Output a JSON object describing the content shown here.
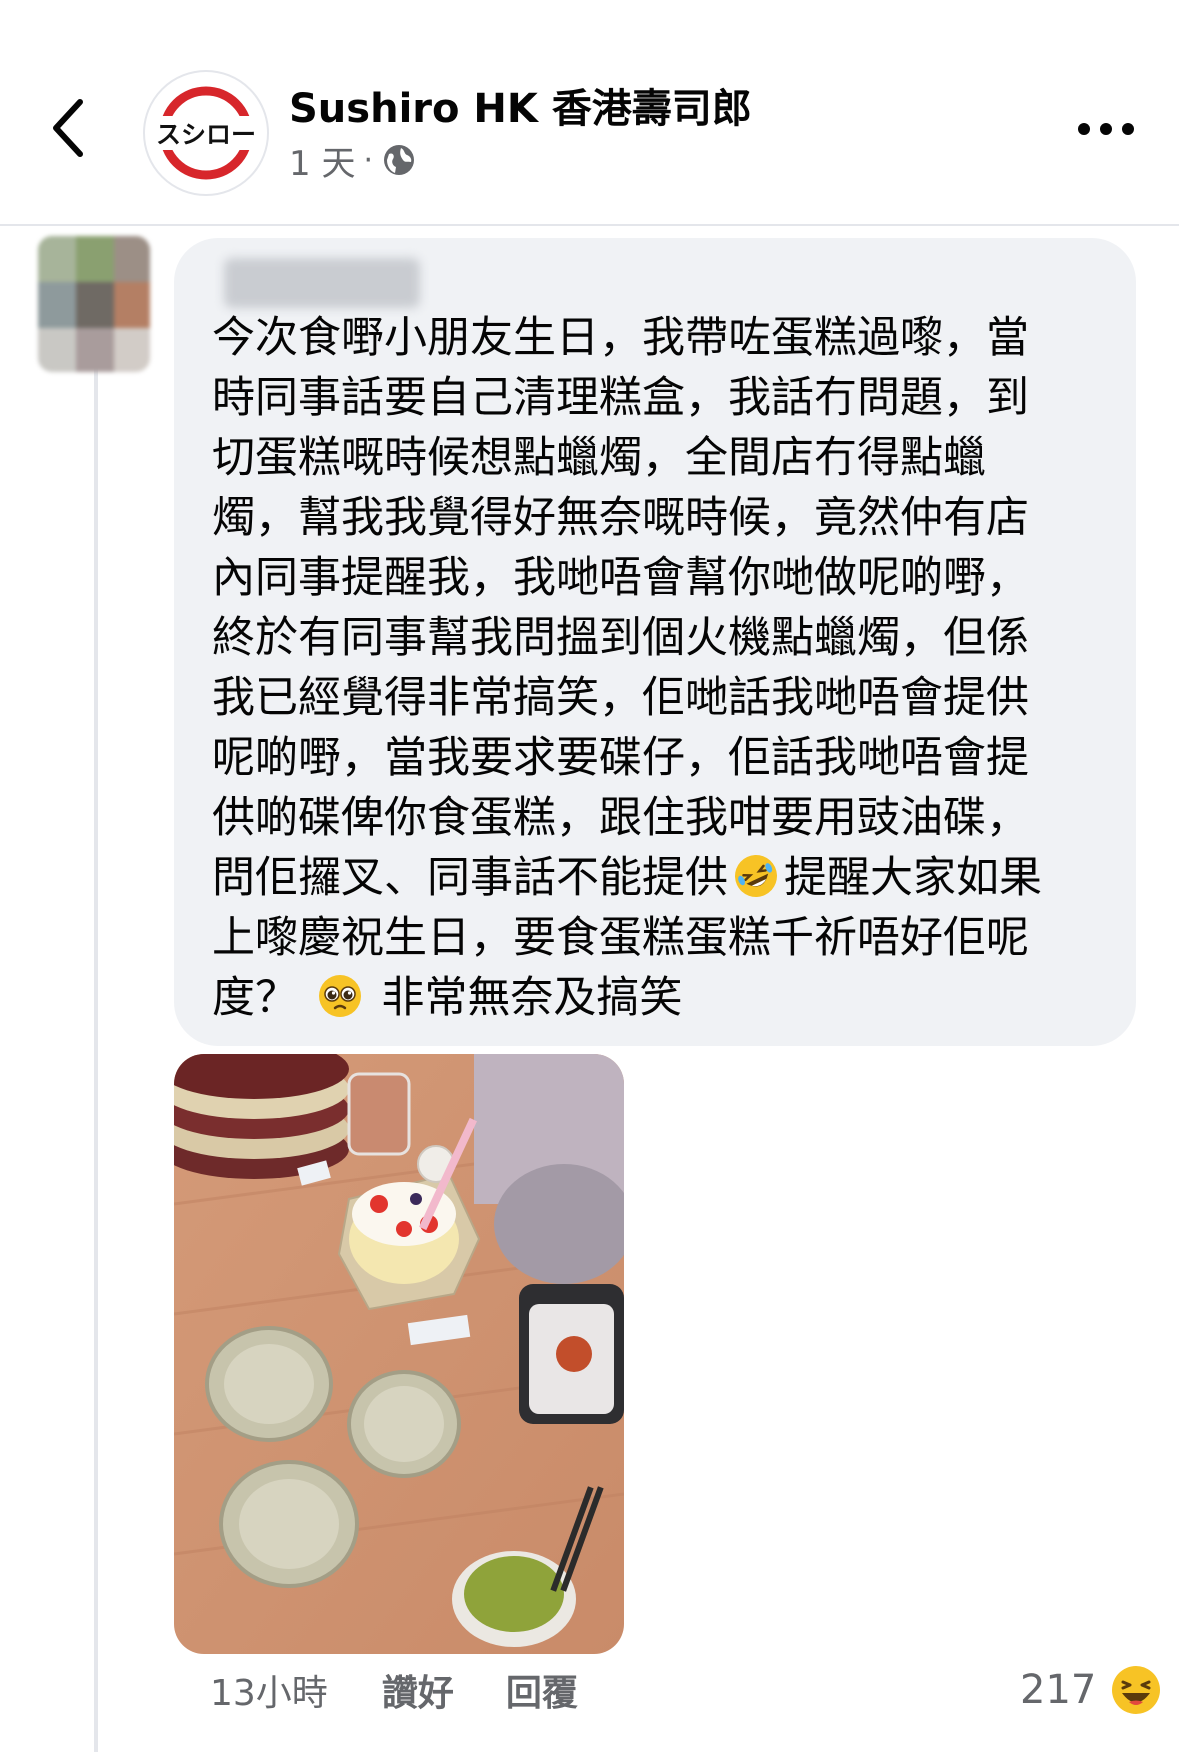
{
  "header": {
    "back_icon": "chevron-left-icon",
    "page_logo_text": "スシロー",
    "page_name": "Sushiro HK 香港壽司郎",
    "post_time": "1 天",
    "separator": "·",
    "audience_icon": "globe-icon",
    "more_icon": "more-dots-icon"
  },
  "comment": {
    "author_name": "",
    "text_lines": [
      "今次食嘢小朋友生日，我帶咗蛋糕過嚟，當",
      "時同事話要自己清理糕盒，我話冇問題，到",
      "切蛋糕嘅時候想點蠟燭，全間店冇得點蠟",
      "燭，幫我我覺得好無奈嘅時候，竟然仲有店",
      "內同事提醒我，我哋唔會幫你哋做呢啲嘢，",
      "終於有同事幫我問搵到個火機點蠟燭，但係",
      "我已經覺得非常搞笑，佢哋話我哋唔會提供",
      "呢啲嘢，當我要求要碟仔，佢話我哋唔會提",
      "供啲碟俾你食蛋糕，跟住我咁要用豉油碟，",
      "問佢攞叉、同事話不能提供",
      "提醒大家如果",
      "上嚟慶祝生日，要食蛋糕蛋糕千祈唔好佢呢",
      "度？",
      "非常無奈及搞笑"
    ],
    "time_ago": "13小時",
    "like_label": "讚好",
    "reply_label": "回覆",
    "reaction_count": "217",
    "reaction_icon": "haha-emoji-icon"
  },
  "colors": {
    "bubble": "#f0f2f5",
    "secondary_text": "#65676b",
    "logo_red": "#d7262b"
  }
}
